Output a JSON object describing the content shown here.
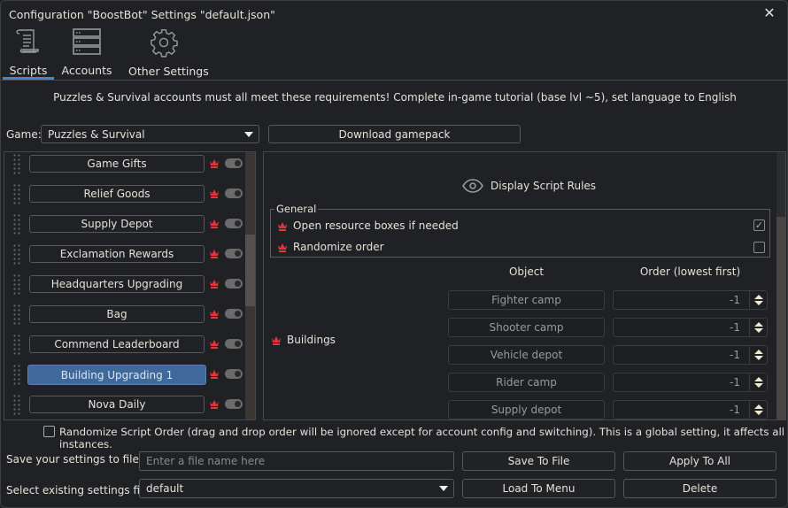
{
  "window": {
    "title": "Configuration \"BoostBot\" Settings \"default.json\"",
    "close_icon": "close-icon"
  },
  "tabs": [
    {
      "label": "Scripts",
      "icon": "scroll-icon",
      "active": true
    },
    {
      "label": "Accounts",
      "icon": "server-icon"
    },
    {
      "label": "Other Settings",
      "icon": "gear-icon"
    }
  ],
  "notice": "Puzzles & Survival accounts must all meet these requirements! Complete in-game tutorial (base lvl ~5), set language to English",
  "game": {
    "label": "Game:",
    "value": "Puzzles & Survival",
    "download_label": "Download gamepack"
  },
  "scripts": [
    {
      "label": "Game Gifts",
      "enabled": true
    },
    {
      "label": "Relief Goods",
      "enabled": true
    },
    {
      "label": "Supply Depot",
      "enabled": true
    },
    {
      "label": "Exclamation Rewards",
      "enabled": true
    },
    {
      "label": "Headquarters Upgrading",
      "enabled": true
    },
    {
      "label": "Bag",
      "enabled": true
    },
    {
      "label": "Commend Leaderboard",
      "enabled": true
    },
    {
      "label": "Building Upgrading 1",
      "enabled": true,
      "selected": true
    },
    {
      "label": "Nova Daily",
      "enabled": true
    }
  ],
  "rules": {
    "display_label": "Display Script Rules",
    "general_title": "General",
    "options": [
      {
        "label": "Open resource boxes if needed",
        "checked": true
      },
      {
        "label": "Randomize order",
        "checked": false
      }
    ],
    "buildings_label": "Buildings",
    "col_object": "Object",
    "col_order": "Order (lowest first)",
    "rows": [
      {
        "object": "Fighter camp",
        "order": "-1"
      },
      {
        "object": "Shooter camp",
        "order": "-1"
      },
      {
        "object": "Vehicle depot",
        "order": "-1"
      },
      {
        "object": "Rider camp",
        "order": "-1"
      },
      {
        "object": "Supply depot",
        "order": "-1"
      }
    ]
  },
  "randomize_global": {
    "label": "Randomize Script Order (drag and drop order will be ignored except for account config and switching). This is a global setting, it affects all instances.",
    "checked": false
  },
  "files": {
    "save_label": "Save your settings to file",
    "save_placeholder": "Enter a file name here",
    "save_button": "Save To File",
    "apply_button": "Apply To All",
    "select_label": "Select existing settings file",
    "select_value": "default",
    "load_button": "Load To Menu",
    "delete_button": "Delete"
  },
  "colors": {
    "accent": "#4a86c8",
    "selected": "#3f689b",
    "crown": "#e0353a"
  }
}
